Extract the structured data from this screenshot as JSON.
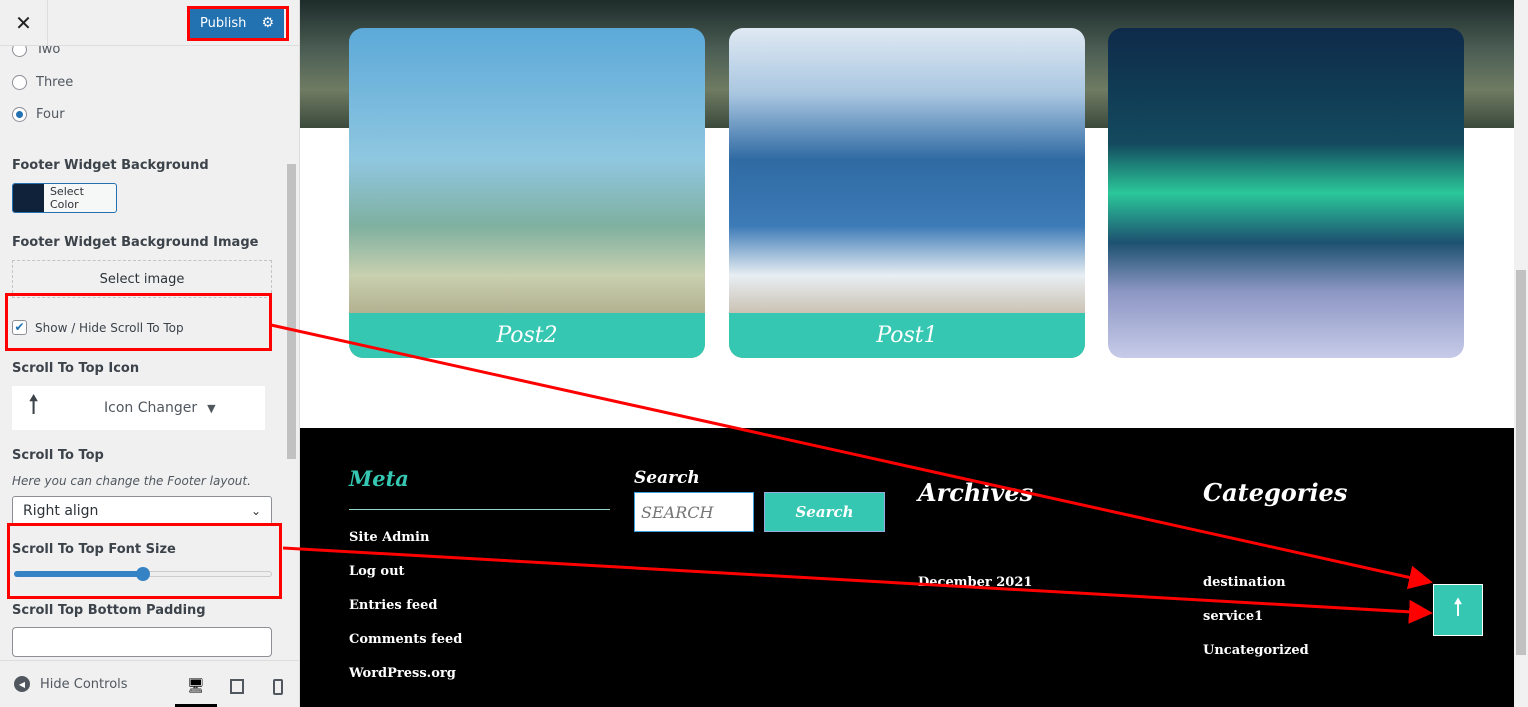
{
  "sidebar": {
    "publish_label": "Publish",
    "radios": [
      {
        "label": "Two",
        "checked": false
      },
      {
        "label": "Three",
        "checked": false
      },
      {
        "label": "Four",
        "checked": true
      }
    ],
    "footer_bg_label": "Footer Widget Background",
    "footer_bg_color": "#10213a",
    "select_color_label": "Select Color",
    "footer_bg_image_label": "Footer Widget Background Image",
    "select_image_label": "Select image",
    "show_hide_label": "Show / Hide Scroll To Top",
    "show_hide_checked": true,
    "icon_label": "Scroll To Top Icon",
    "icon_changer_label": "Icon Changer",
    "scroll_top_label": "Scroll To Top",
    "scroll_top_desc": "Here you can change the Footer layout.",
    "align_value": "Right align",
    "font_size_label": "Scroll To Top Font Size",
    "font_size_percent": 50,
    "padding_label": "Scroll Top Bottom Padding",
    "padding_value": "",
    "hide_controls_label": "Hide Controls"
  },
  "preview": {
    "posts": [
      {
        "title": "Post2"
      },
      {
        "title": "Post1"
      },
      {
        "title": ""
      }
    ],
    "footer": {
      "meta_title": "Meta",
      "meta_links": [
        "Site Admin",
        "Log out",
        "Entries feed",
        "Comments feed",
        "WordPress.org"
      ],
      "search_title": "Search",
      "search_placeholder": "SEARCH",
      "search_button": "Search",
      "archives_title": "Archives",
      "archives": [
        "December 2021"
      ],
      "categories_title": "Categories",
      "categories": [
        "destination",
        "service1",
        "Uncategorized"
      ]
    },
    "accent_color": "#35c7b1"
  }
}
